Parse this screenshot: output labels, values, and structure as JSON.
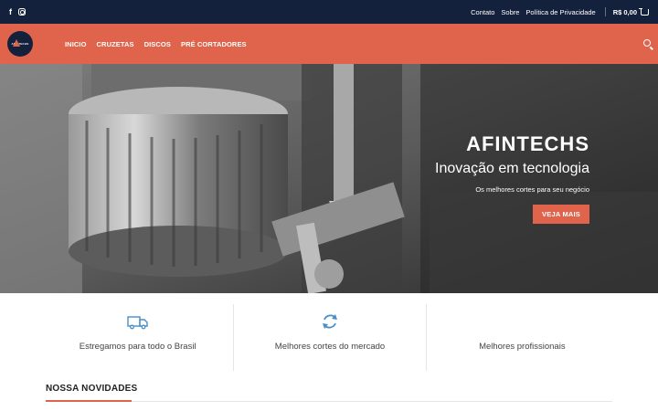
{
  "colors": {
    "topbar_bg": "#14213d",
    "accent": "#e0644c",
    "icon_blue": "#4a8ec7"
  },
  "topbar": {
    "social": [
      "facebook-icon",
      "instagram-icon"
    ],
    "links": [
      "Contato",
      "Sobre",
      "Política de Privacidade"
    ],
    "cart_total": "R$ 0,00"
  },
  "header": {
    "logo_text": "AFINTECHS",
    "nav": [
      "INICIO",
      "CRUZETAS",
      "DISCOS",
      "PRÉ CORTADORES"
    ]
  },
  "hero": {
    "title": "AFINTECHS",
    "subtitle": "Inovação em tecnologia",
    "description": "Os melhores cortes para seu negócio",
    "button": "VEJA MAIS"
  },
  "features": [
    {
      "icon": "truck-icon",
      "label": "Estregamos para todo o Brasil"
    },
    {
      "icon": "refresh-icon",
      "label": "Melhores cortes do mercado"
    },
    {
      "icon": "",
      "label": "Melhores profissionais"
    }
  ],
  "news": {
    "title": "NOSSA NOVIDADES"
  }
}
